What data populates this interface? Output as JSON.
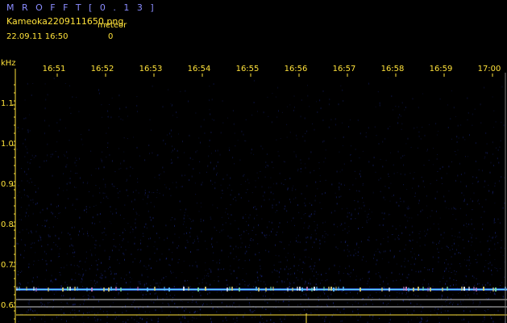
{
  "header": {
    "app_title": "M R O F F T  [ 0 . 1 3 ]",
    "file_name": "Kameoka2209111650.png",
    "meteor_label": "meteor",
    "datetime": "22.09.11  16:50",
    "meteor_count": "0"
  },
  "axes": {
    "y_unit": "kHz",
    "y_ticks": [
      "1.1",
      "1.0",
      "0.9",
      "0.8",
      "0.7",
      "0.6"
    ],
    "x_ticks": [
      "16:51",
      "16:52",
      "16:53",
      "16:54",
      "16:55",
      "16:56",
      "16:57",
      "16:58",
      "16:59",
      "17:00"
    ]
  },
  "colors": {
    "background": "#000000",
    "axis_text": "#ffe23a",
    "title_text": "#8a8cff",
    "noise": "#1c2a8c",
    "carrier_line": "#5fd7ff"
  }
}
